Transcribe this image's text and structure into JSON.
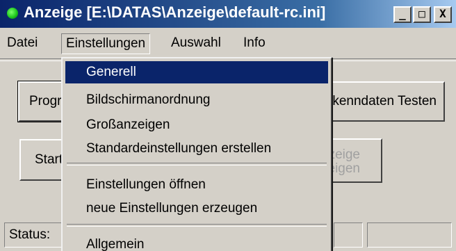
{
  "window": {
    "title": "Anzeige [E:\\DATAS\\Anzeige\\default-rc.ini]",
    "minimize": "_",
    "maximize": "□",
    "close": "X"
  },
  "menubar": {
    "items": [
      "Datei",
      "Einstellungen",
      "Auswahl",
      "Info"
    ]
  },
  "main": {
    "prog_button": "Programm",
    "start_button": "Start",
    "test_button": "Spielerkenndaten Testen",
    "anzeige_button_line1": "Anzeige",
    "anzeige_button_line2": "anzeigen"
  },
  "statusbar": {
    "label": "Status:"
  },
  "dropdown": {
    "items": [
      "Generell",
      "Bildschirmanordnung",
      "Großanzeigen",
      "Standardeinstellungen erstellen",
      "Einstellungen öffnen",
      "neue Einstellungen erzeugen",
      "Allgemein"
    ],
    "highlighted_index": 0
  }
}
